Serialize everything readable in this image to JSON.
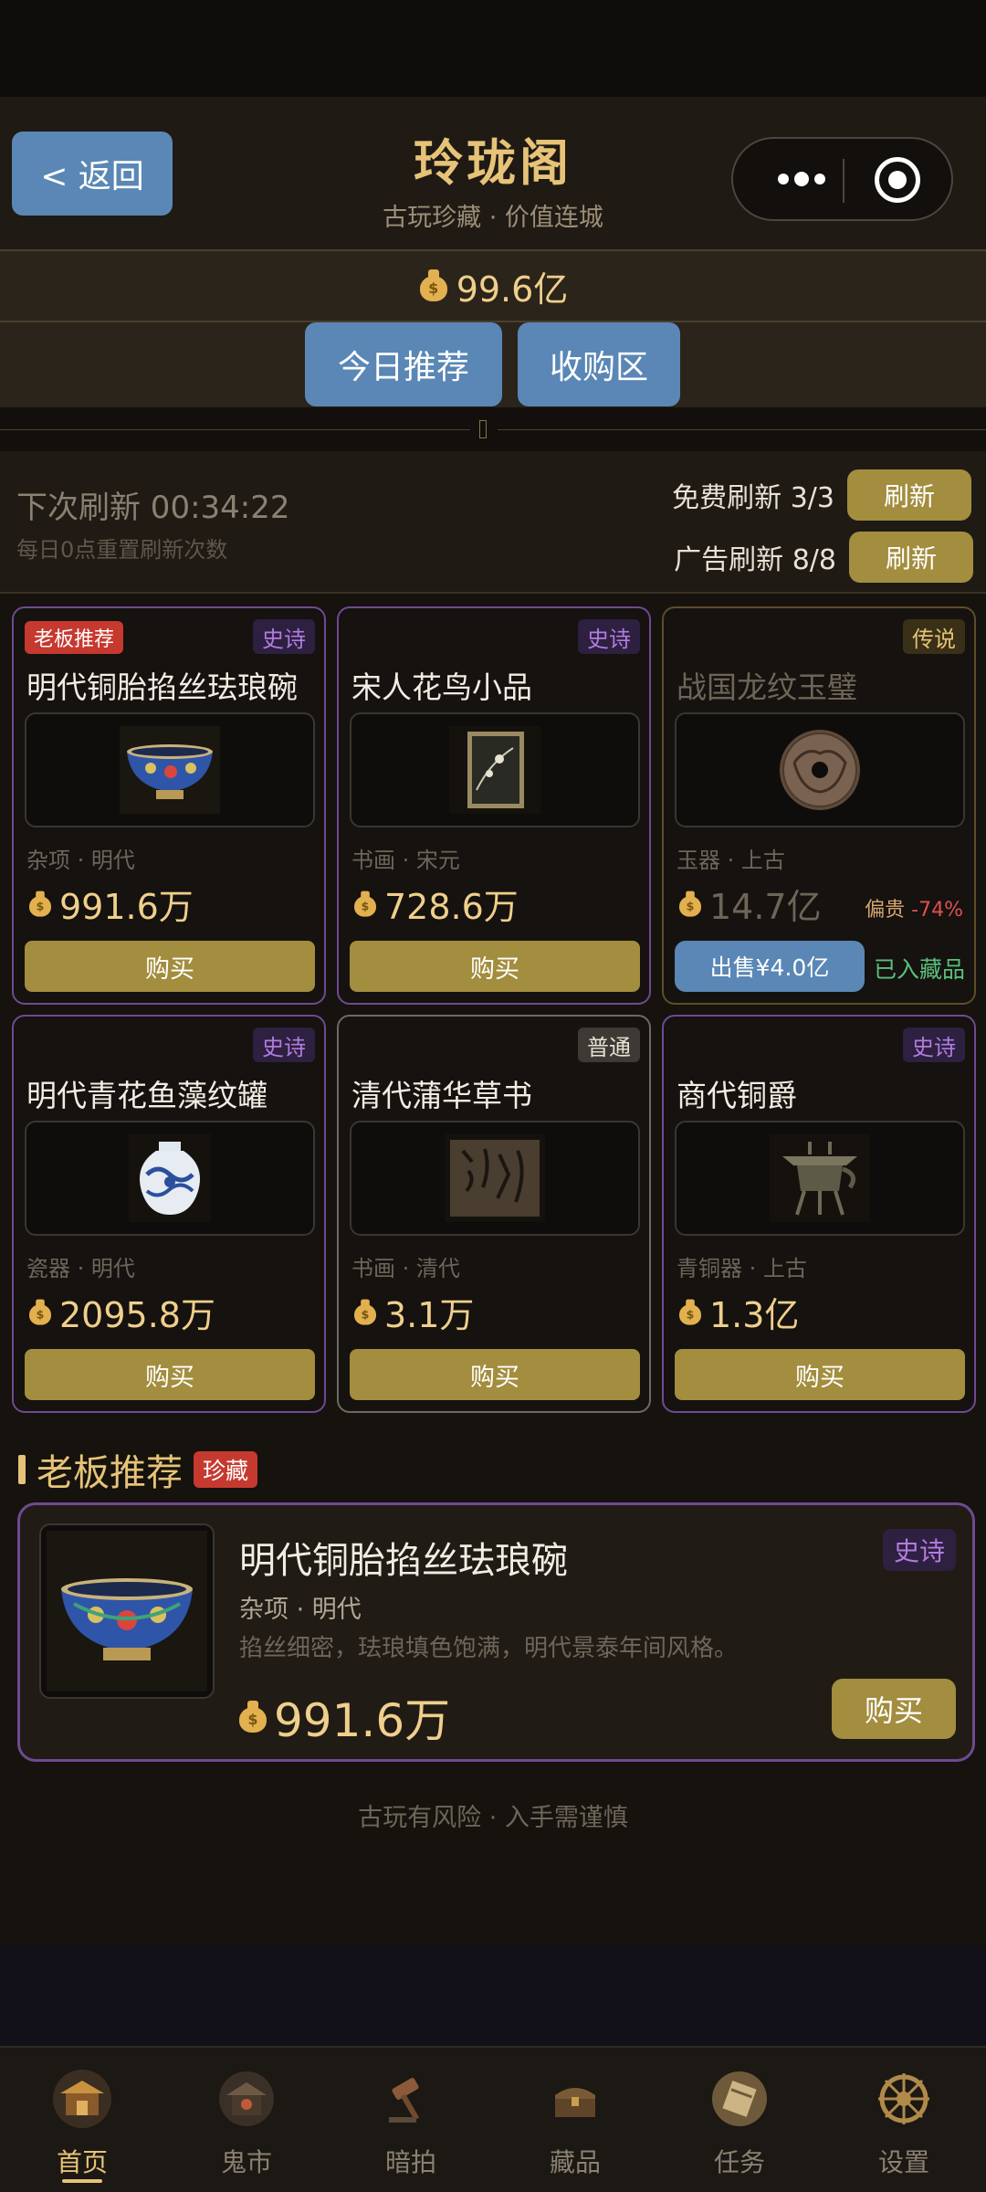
{
  "header": {
    "back_label": "< 返回",
    "title": "玲珑阁",
    "subtitle": "古玩珍藏 · 价值连城"
  },
  "balance": {
    "amount": "99.6亿"
  },
  "tabs": [
    {
      "label": "今日推荐",
      "active": true
    },
    {
      "label": "收购区",
      "active": false
    }
  ],
  "refresh": {
    "next_label": "下次刷新 00:34:22",
    "reset_note": "每日0点重置刷新次数",
    "free_label": "免费刷新 3/3",
    "ad_label": "广告刷新 8/8",
    "button_label": "刷新"
  },
  "items": [
    {
      "tag": "老板推荐",
      "rarity": "史诗",
      "name": "明代铜胎掐丝珐琅碗",
      "category": "杂项 · 明代",
      "price": "991.6万",
      "button": "购买"
    },
    {
      "rarity": "史诗",
      "name": "宋人花鸟小品",
      "category": "书画 · 宋元",
      "price": "728.6万",
      "button": "购买"
    },
    {
      "rarity": "传说",
      "name": "战国龙纹玉璧",
      "category": "玉器 · 上古",
      "price": "14.7亿",
      "overprice_label": "偏贵",
      "overprice_pct": "-74%",
      "sell_button": "出售¥4.0亿",
      "owned_label": "已入藏品"
    },
    {
      "rarity": "史诗",
      "name": "明代青花鱼藻纹罐",
      "category": "瓷器 · 明代",
      "price": "2095.8万",
      "button": "购买"
    },
    {
      "rarity": "普通",
      "name": "清代蒲华草书",
      "category": "书画 · 清代",
      "price": "3.1万",
      "button": "购买"
    },
    {
      "rarity": "史诗",
      "name": "商代铜爵",
      "category": "青铜器 · 上古",
      "price": "1.3亿",
      "button": "购买"
    }
  ],
  "boss": {
    "section_title": "老板推荐",
    "section_badge": "珍藏",
    "name": "明代铜胎掐丝珐琅碗",
    "rarity": "史诗",
    "category": "杂项 · 明代",
    "description": "掐丝细密，珐琅填色饱满，明代景泰年间风格。",
    "price": "991.6万",
    "button": "购买"
  },
  "footer_note": "古玩有风险 · 入手需谨慎",
  "tabbar": [
    {
      "label": "首页",
      "icon": "pavilion-icon",
      "active": true
    },
    {
      "label": "鬼市",
      "icon": "night-market-icon",
      "active": false
    },
    {
      "label": "暗拍",
      "icon": "auction-gavel-icon",
      "active": false
    },
    {
      "label": "藏品",
      "icon": "treasure-chest-icon",
      "active": false
    },
    {
      "label": "任务",
      "icon": "scroll-icon",
      "active": false
    },
    {
      "label": "设置",
      "icon": "settings-wheel-icon",
      "active": false
    }
  ],
  "colors": {
    "accent_gold": "#e6c378",
    "button_gold": "#a38d3e",
    "button_blue": "#5a87b5",
    "epic_purple": "#6e4a93",
    "tag_red": "#c6392f",
    "owned_green": "#5bbf7c"
  }
}
